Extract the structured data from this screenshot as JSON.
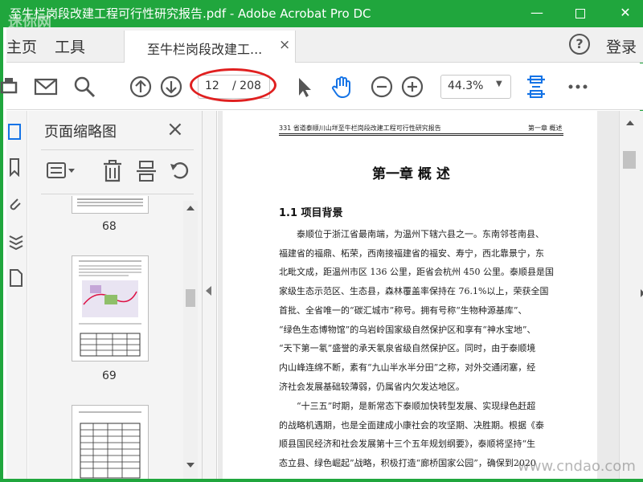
{
  "titlebar": {
    "title": "至牛栏岗段改建工程可行性研究报告.pdf - Adobe Acrobat Pro DC",
    "watermark": "迷你网"
  },
  "menubar": {
    "home": "主页",
    "tools": "工具",
    "tab_label": "至牛栏岗段改建工...",
    "tab_close": "×",
    "help": "?",
    "login": "登录"
  },
  "toolbar": {
    "current_page": "12",
    "total_pages": "/ 208",
    "zoom": "44.3%",
    "highlight_color": "#e02020"
  },
  "thumb_panel": {
    "title": "页面缩略图",
    "close": "×",
    "pages": [
      "68",
      "69"
    ]
  },
  "document": {
    "header_left": "331 省道泰顺川山垟至牛栏岗段改建工程可行性研究报告",
    "header_right": "第一章  概述",
    "chapter_title": "第一章  概  述",
    "section_title": "1.1 项目背景",
    "para1": [
      "泰顺位于浙江省最南端，为温州下辖六县之一。东南邻苍南县、",
      "福建省的福鼎、柘荣，西南接福建省的福安、寿宁，西北靠景宁，东",
      "北毗文成，距温州市区 136 公里，距省会杭州 450 公里。泰顺县是国",
      "家级生态示范区、生态县，森林覆盖率保持在 76.1%以上，荣获全国",
      "首批、全省唯一的“碳汇城市”称号。拥有号称“生物种源基库”、",
      "“绿色生态博物馆”的乌岩岭国家级自然保护区和享有“神水宝地”、",
      "“天下第一氡”盛誉的承天氡泉省级自然保护区。同时，由于泰顺境",
      "内山峰连绵不断，素有“九山半水半分田”之称，对外交通闭塞，经",
      "济社会发展基础较薄弱，仍属省内欠发达地区。"
    ],
    "para2": [
      "“十三五”时期，是新常态下泰顺加快转型发展、实现绿色赶超",
      "的战略机遇期，也是全面建成小康社会的攻坚期、决胜期。根据《泰",
      "顺县国民经济和社会发展第十三个五年规划纲要》，泰顺将坚持“生",
      "态立县、绿色崛起”战略，积极打造“廊桥国家公园”，确保到2020"
    ]
  },
  "footer_watermark": "www.cndao.com",
  "colors": {
    "title_bar": "#20a63d",
    "accent_blue": "#1473e6"
  }
}
